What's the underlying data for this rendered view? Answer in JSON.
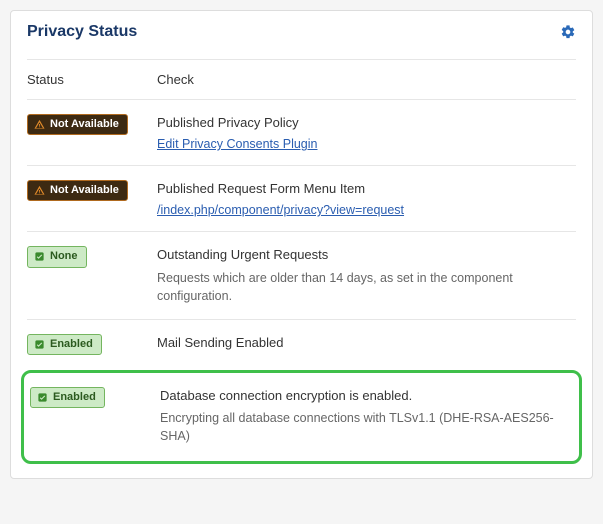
{
  "panel": {
    "title": "Privacy Status"
  },
  "columns": {
    "status": "Status",
    "check": "Check"
  },
  "badges": {
    "not_available": "Not Available",
    "none": "None",
    "enabled": "Enabled"
  },
  "rows": [
    {
      "status_type": "na",
      "title": "Published Privacy Policy",
      "link": "Edit Privacy Consents Plugin"
    },
    {
      "status_type": "na",
      "title": "Published Request Form Menu Item",
      "link": "/index.php/component/privacy?view=request"
    },
    {
      "status_type": "none",
      "title": "Outstanding Urgent Requests",
      "desc": "Requests which are older than 14 days, as set in the component configuration."
    },
    {
      "status_type": "enabled",
      "title": "Mail Sending Enabled"
    },
    {
      "status_type": "enabled",
      "title": "Database connection encryption is enabled.",
      "desc": "Encrypting all database connections with TLSv1.1 (DHE-RSA-AES256-SHA)",
      "highlight": true
    }
  ]
}
